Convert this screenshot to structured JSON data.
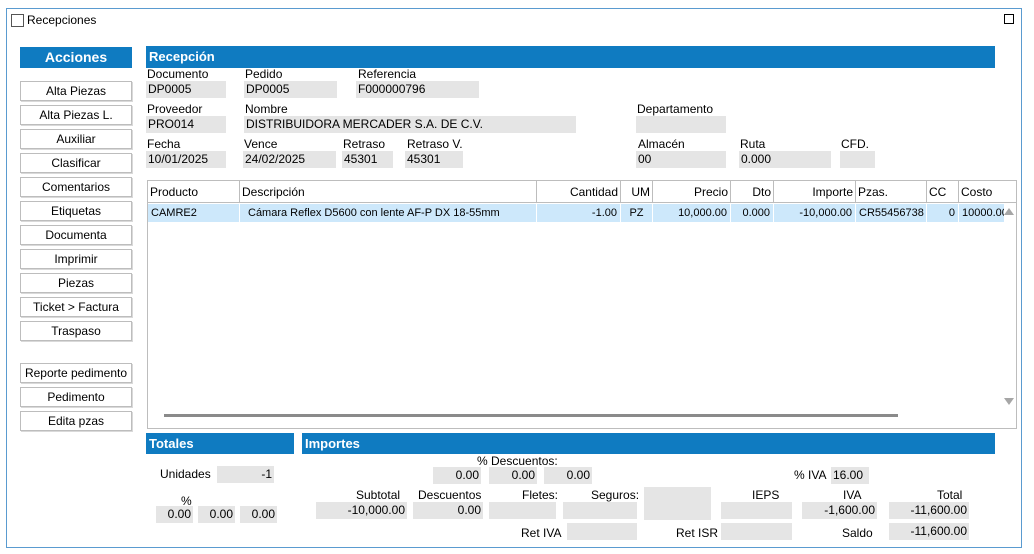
{
  "window": {
    "title": "Recepciones"
  },
  "acciones": {
    "header": "Acciones",
    "buttons": [
      "Alta Piezas",
      "Alta Piezas L.",
      "Auxiliar",
      "Clasificar",
      "Comentarios",
      "Etiquetas",
      "Documenta",
      "Imprimir",
      "Piezas",
      "Ticket > Factura",
      "Traspaso"
    ],
    "extra_buttons": [
      "Reporte pedimento",
      "Pedimento",
      "Edita pzas"
    ]
  },
  "recepcion": {
    "header": "Recepción",
    "documento_label": "Documento",
    "documento": "DP0005",
    "pedido_label": "Pedido",
    "pedido": "DP0005",
    "referencia_label": "Referencia",
    "referencia": "F000000796",
    "proveedor_label": "Proveedor",
    "proveedor": "PRO014",
    "nombre_label": "Nombre",
    "nombre": "DISTRIBUIDORA MERCADER S.A. DE C.V.",
    "departamento_label": "Departamento",
    "departamento": "",
    "fecha_label": "Fecha",
    "fecha": "10/01/2025",
    "vence_label": "Vence",
    "vence": "24/02/2025",
    "retraso_label": "Retraso",
    "retraso": "45301",
    "retraso_v_label": "Retraso V.",
    "retraso_v": "45301",
    "almacen_label": "Almacén",
    "almacen": "00",
    "ruta_label": "Ruta",
    "ruta": "0.000",
    "cfd_label": "CFD.",
    "cfd": ""
  },
  "grid": {
    "columns": [
      "Producto",
      "Descripción",
      "Cantidad",
      "UM",
      "Precio",
      "Dto",
      "Importe",
      "Pzas.",
      "CC",
      "Costo"
    ],
    "rows": [
      {
        "producto": "CAMRE2",
        "descripcion": "Cámara Reflex D5600 con lente AF-P DX 18-55mm",
        "cantidad": "-1.00",
        "um": "PZ",
        "precio": "10,000.00",
        "dto": "0.000",
        "importe": "-10,000.00",
        "pzas": "CR55456738",
        "cc": "0",
        "costo": "10000.00"
      }
    ]
  },
  "totales": {
    "header": "Totales",
    "unidades_label": "Unidades",
    "unidades": "-1",
    "pct_label": "%",
    "pct_values": [
      "0.00",
      "0.00",
      "0.00"
    ]
  },
  "importes": {
    "header": "Importes",
    "descuentos_pct_label": "% Descuentos:",
    "descuentos_pct_values": [
      "0.00",
      "0.00",
      "0.00"
    ],
    "iva_pct_label": "% IVA",
    "iva_pct": "16.00",
    "subtotal_label": "Subtotal",
    "subtotal": "-10,000.00",
    "descuentos_label": "Descuentos",
    "descuentos": "0.00",
    "fletes_label": "Fletes:",
    "fletes": "",
    "seguros_label": "Seguros:",
    "seguros": "",
    "ieps_label": "IEPS",
    "ieps": "",
    "iva_label": "IVA",
    "iva": "-1,600.00",
    "total_label": "Total",
    "total": "-11,600.00",
    "ret_iva_label": "Ret IVA",
    "ret_iva": "",
    "ret_isr_label": "Ret ISR",
    "ret_isr": "",
    "saldo_label": "Saldo",
    "saldo": "-11,600.00"
  },
  "colors": {
    "accent": "#0f7bc1",
    "field_bg": "#e5e5e5",
    "selected_row": "#cde8fb",
    "window_border": "#5a9bd0"
  }
}
